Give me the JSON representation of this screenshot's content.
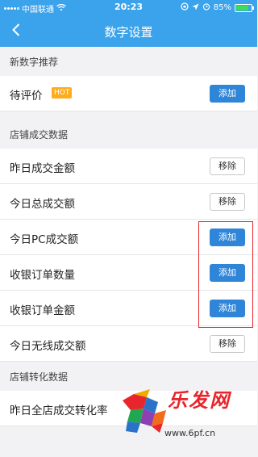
{
  "status": {
    "carrier": "中国联通",
    "time": "20:23",
    "battery": "85%",
    "battery_fraction": 0.85
  },
  "nav": {
    "title": "数字设置"
  },
  "sections": [
    {
      "title": "新数字推荐"
    },
    {
      "title": "店铺成交数据"
    },
    {
      "title": "店铺转化数据"
    }
  ],
  "rows": [
    {
      "label": "待评价",
      "badge": "HOT",
      "button": "添加"
    },
    {
      "label": "昨日成交金额",
      "button": "移除"
    },
    {
      "label": "今日总成交额",
      "button": "移除"
    },
    {
      "label": "今日PC成交额",
      "button": "添加"
    },
    {
      "label": "收银订单数量",
      "button": "添加"
    },
    {
      "label": "收银订单金额",
      "button": "添加"
    },
    {
      "label": "今日无线成交额",
      "button": "移除"
    },
    {
      "label": "昨日全店成交转化率"
    }
  ],
  "watermark": {
    "logo_text": "乐发网",
    "url": "www.6pf.cn"
  },
  "colors": {
    "header": "#3aa3ec",
    "add_button": "#2f86d9",
    "hot_badge": "#ffac1c",
    "highlight_box": "#e8252c"
  }
}
